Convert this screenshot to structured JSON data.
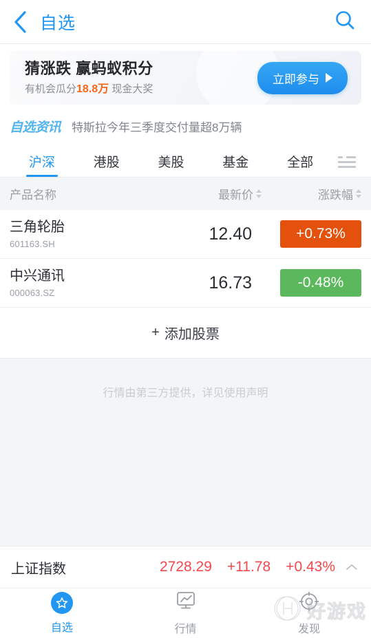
{
  "header": {
    "back_icon": "chevron-left-icon",
    "title": "自选",
    "search_icon": "search-icon"
  },
  "banner": {
    "title": "猜涨跌 赢蚂蚁积分",
    "sub_prefix": "有机会瓜分",
    "sub_highlight": "18.8万",
    "sub_suffix": "现金大奖",
    "cta_label": "立即参与",
    "cta_icon": "play-triangle-icon",
    "highlight_color": "#f4671c",
    "cta_color": "#1f8ced"
  },
  "news": {
    "logo": "自选资讯",
    "headline": "特斯拉今年三季度交付量超8万辆"
  },
  "tabs": {
    "items": [
      {
        "label": "沪深",
        "active": true
      },
      {
        "label": "港股",
        "active": false
      },
      {
        "label": "美股",
        "active": false
      },
      {
        "label": "基金",
        "active": false
      },
      {
        "label": "全部",
        "active": false
      }
    ],
    "menu_icon": "list-menu-icon",
    "active_color": "#2196f3"
  },
  "table": {
    "columns": [
      "产品名称",
      "最新价",
      "涨跌幅"
    ],
    "rows": [
      {
        "name": "三角轮胎",
        "code": "601163.SH",
        "price": "12.40",
        "change": "+0.73%",
        "direction": "up"
      },
      {
        "name": "中兴通讯",
        "code": "000063.SZ",
        "price": "16.73",
        "change": "-0.48%",
        "direction": "down"
      }
    ],
    "add_label": "添加股票",
    "add_plus": "+",
    "up_color": "#e4510c",
    "down_color": "#5cb85c"
  },
  "disclaimer": "行情由第三方提供，详见使用声明",
  "index_bar": {
    "name": "上证指数",
    "value": "2728.29",
    "change": "+11.78",
    "percent": "+0.43%",
    "toggle_icon": "chevron-up-icon",
    "color": "#f5474c"
  },
  "tabbar": {
    "items": [
      {
        "label": "自选",
        "icon": "star-icon",
        "active": true
      },
      {
        "label": "行情",
        "icon": "monitor-chart-icon",
        "active": false
      },
      {
        "label": "发现",
        "icon": "compass-icon",
        "active": false
      }
    ]
  },
  "watermark": {
    "logo_icon": "h-circle-logo-icon",
    "text": "好游戏"
  }
}
